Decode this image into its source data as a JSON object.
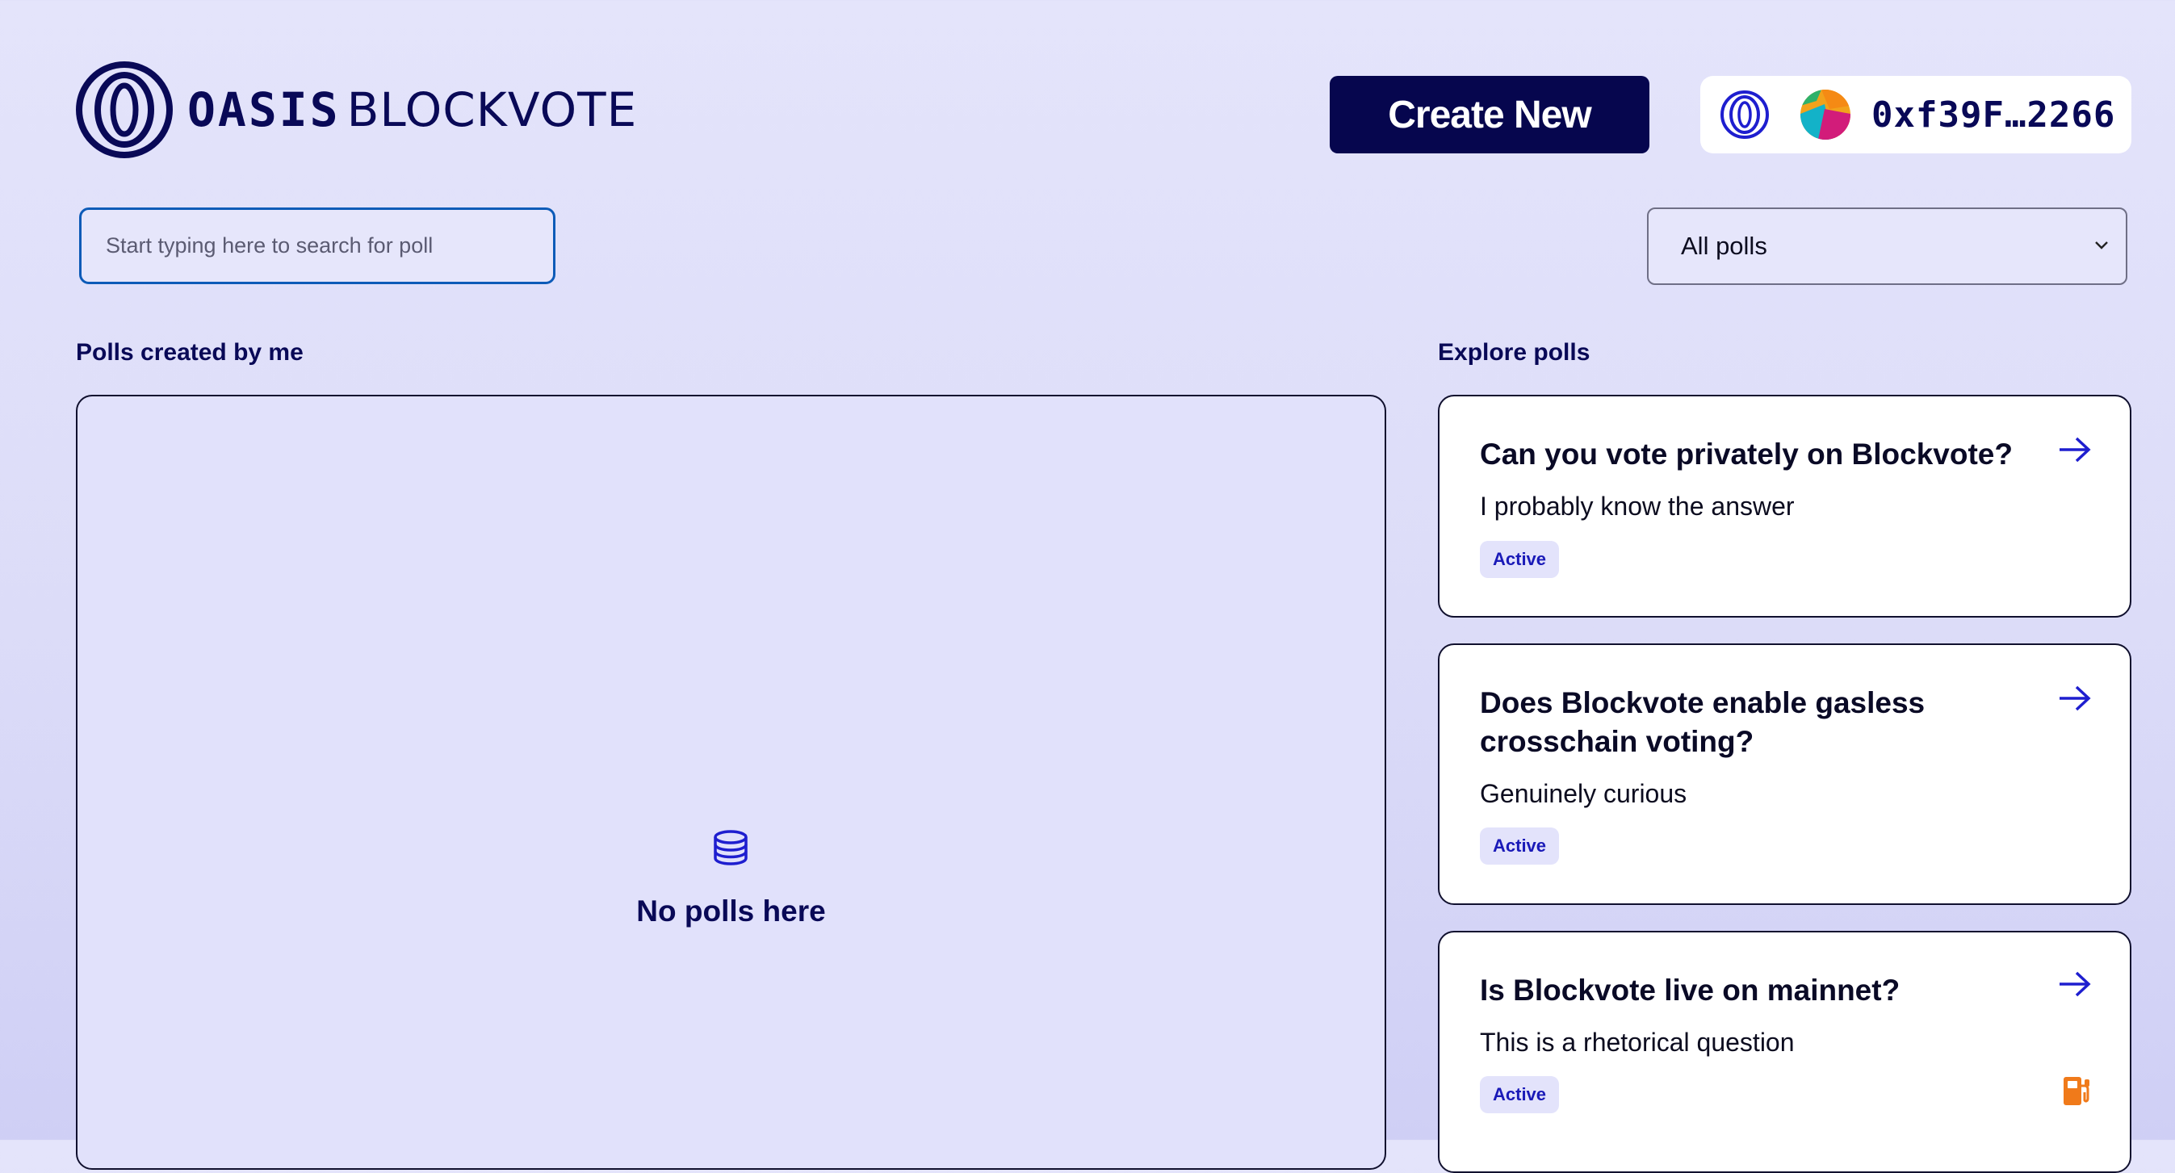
{
  "header": {
    "logo_word1": "OASIS",
    "logo_word2": "BLOCKVOTE",
    "create_label": "Create New",
    "wallet": {
      "network_icon": "oasis-network-icon",
      "avatar_icon": "jazzicon-avatar",
      "address": "0xf39F…2266"
    }
  },
  "search": {
    "placeholder": "Start typing here to search for poll",
    "value": ""
  },
  "filter": {
    "selected": "All polls"
  },
  "my_polls": {
    "title": "Polls created by me",
    "empty_icon": "database-icon",
    "empty_text": "No polls here"
  },
  "explore": {
    "title": "Explore polls",
    "polls": [
      {
        "title": "Can you vote privately on Blockvote?",
        "description": "I probably know the answer",
        "status": "Active",
        "gasless": false
      },
      {
        "title": "Does Blockvote enable gasless crosschain voting?",
        "description": "Genuinely curious",
        "status": "Active",
        "gasless": false
      },
      {
        "title": "Is Blockvote live on mainnet?",
        "description": "This is a rhetorical question",
        "status": "Active",
        "gasless": true
      }
    ]
  },
  "colors": {
    "accent_dark": "#06064e",
    "link_blue": "#1a1ab8",
    "gas_orange": "#f07a1a",
    "background": "#e4e4fb"
  }
}
